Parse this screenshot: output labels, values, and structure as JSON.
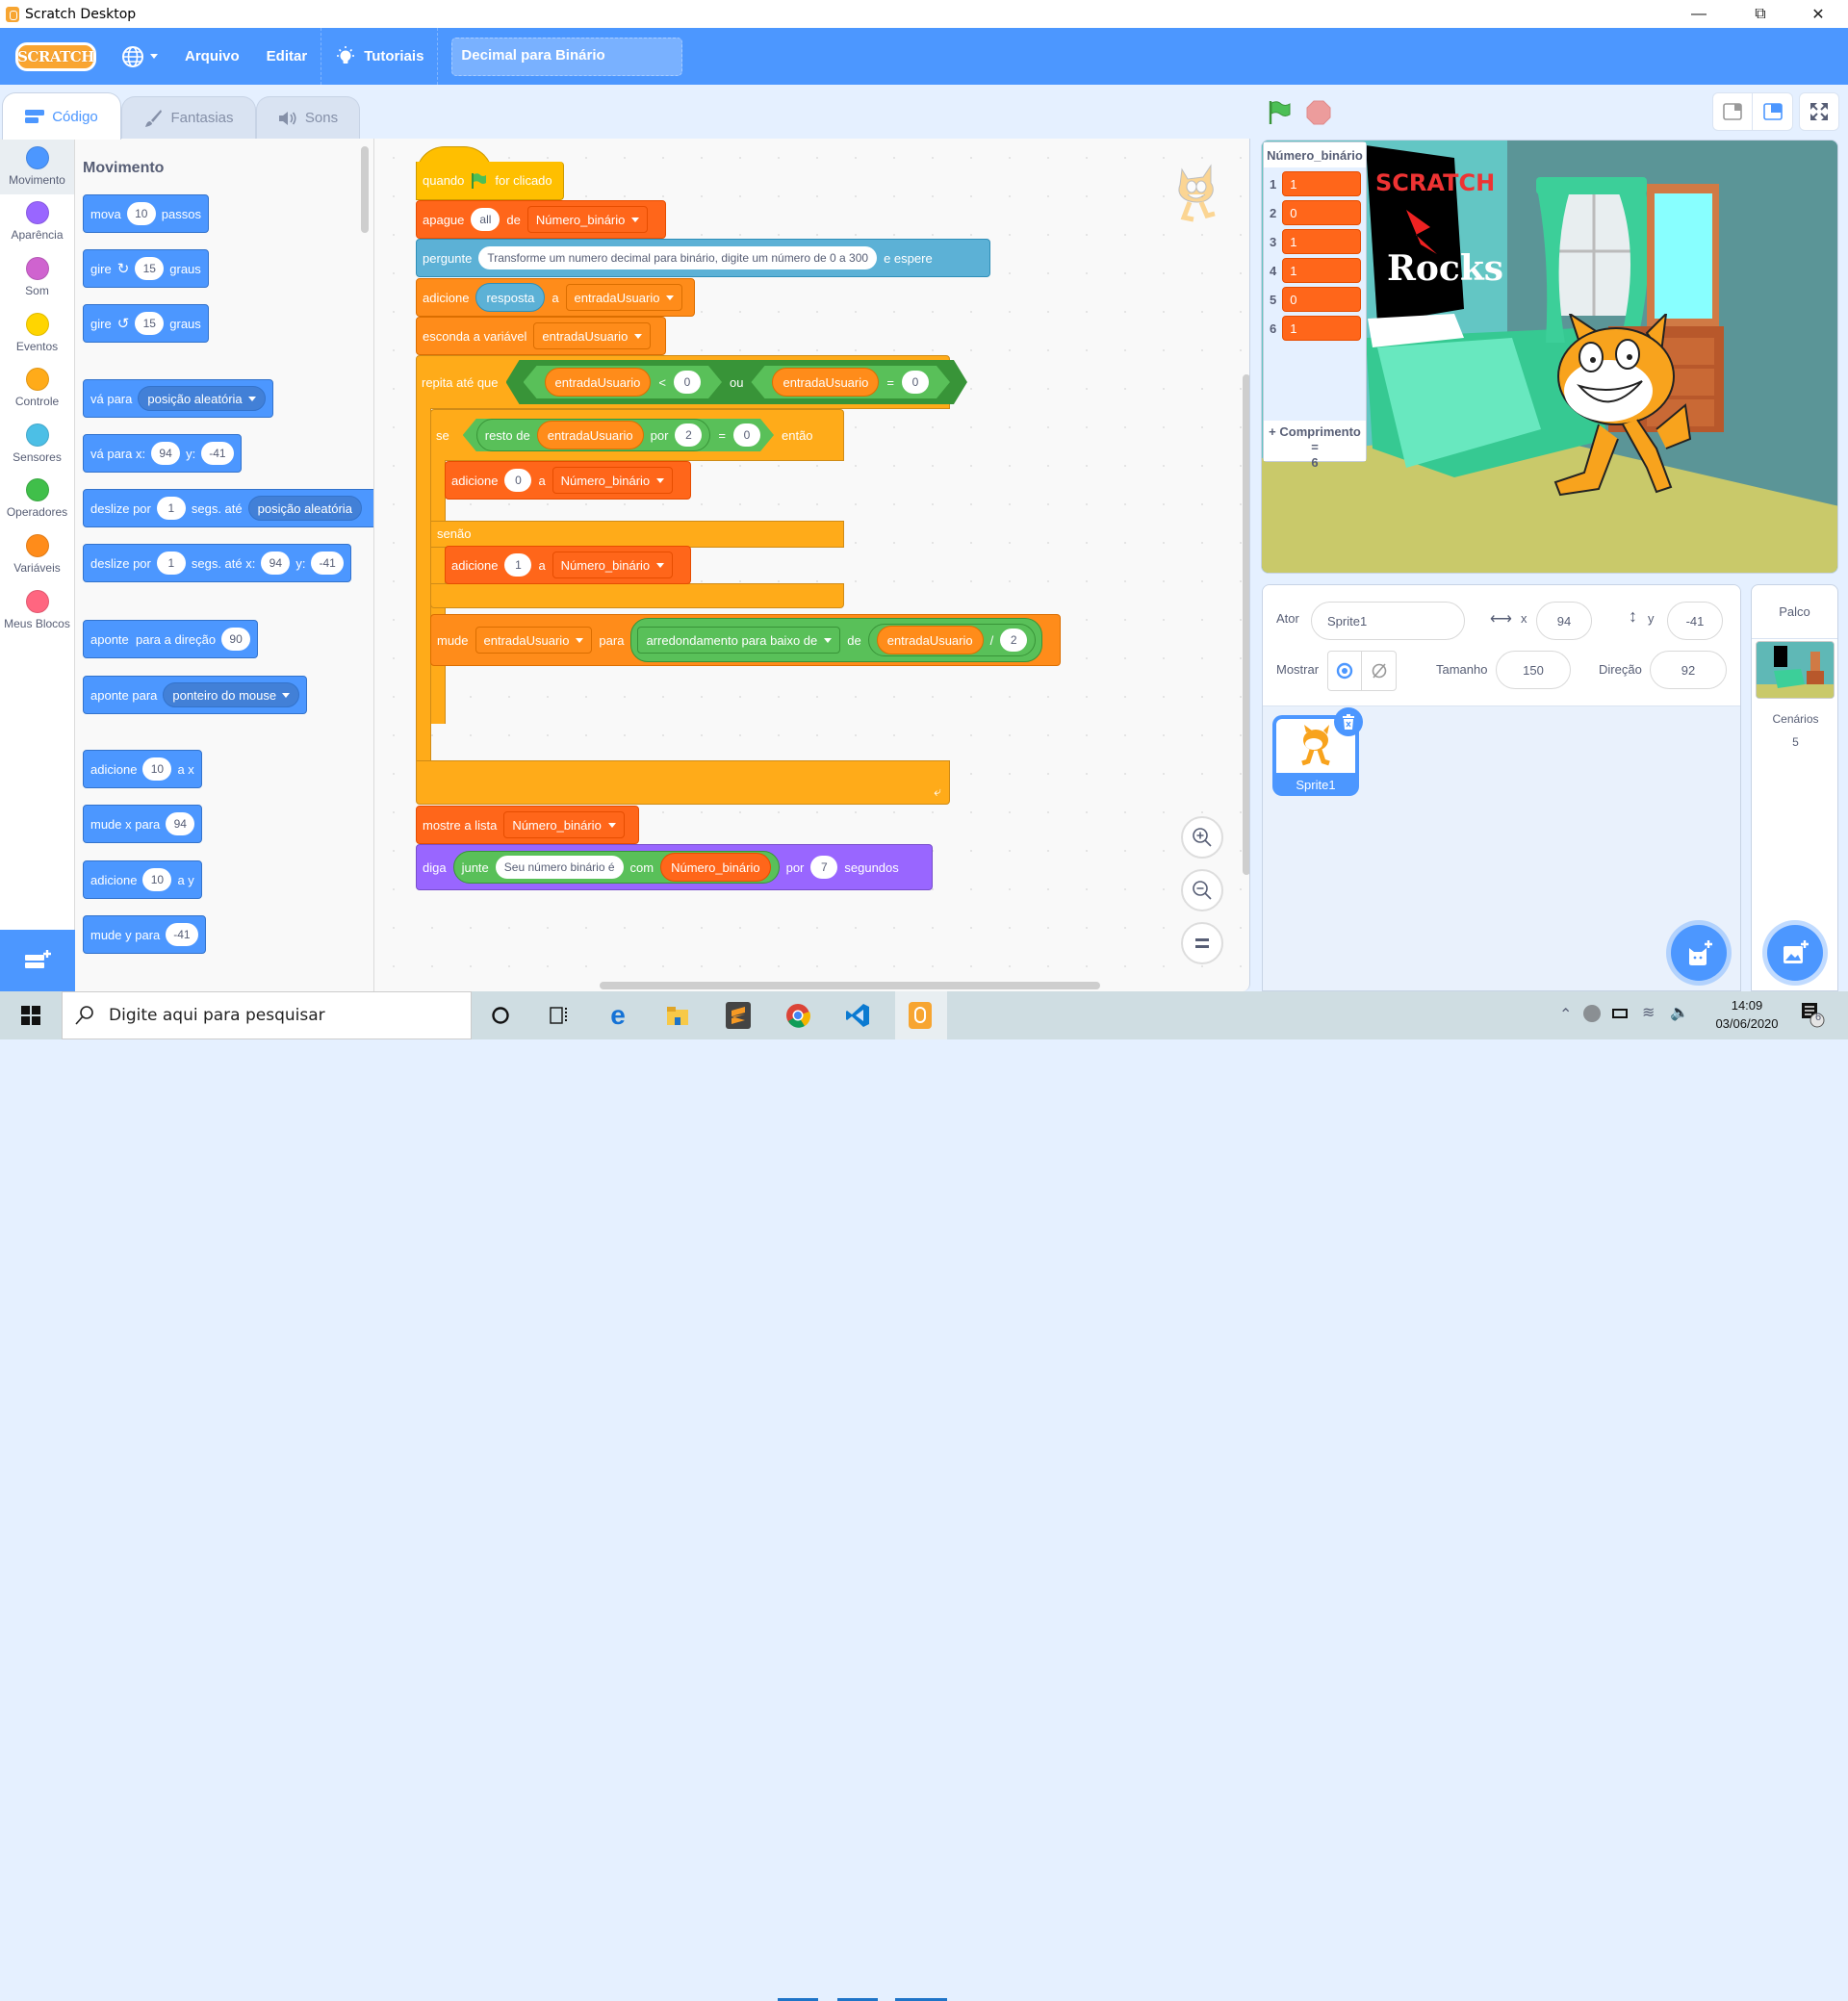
{
  "window": {
    "title": "Scratch Desktop",
    "controls": [
      "minimize-icon",
      "restore-icon",
      "close-icon"
    ]
  },
  "menubar": {
    "logo_text": "SCRATCH",
    "language_icon": "globe-icon",
    "items": [
      "Arquivo",
      "Editar"
    ],
    "tutorials": "Tutoriais",
    "project_title": "Decimal para Binário"
  },
  "tabs": [
    {
      "label": "Código",
      "icon": "code-icon",
      "active": true
    },
    {
      "label": "Fantasias",
      "icon": "brush-icon",
      "active": false
    },
    {
      "label": "Sons",
      "icon": "speaker-icon",
      "active": false
    }
  ],
  "categories": [
    {
      "label": "Movimento",
      "color": "#4c97ff",
      "active": true
    },
    {
      "label": "Aparência",
      "color": "#9966ff"
    },
    {
      "label": "Som",
      "color": "#cf63cf"
    },
    {
      "label": "Eventos",
      "color": "#ffd500"
    },
    {
      "label": "Controle",
      "color": "#ffab19"
    },
    {
      "label": "Sensores",
      "color": "#4cbfe6"
    },
    {
      "label": "Operadores",
      "color": "#40bf4a"
    },
    {
      "label": "Variáveis",
      "color": "#ff8c1a"
    },
    {
      "label": "Meus Blocos",
      "color": "#ff6680"
    }
  ],
  "palette": {
    "heading": "Movimento",
    "blocks": {
      "move": {
        "a": "mova",
        "v": "10",
        "b": "passos"
      },
      "turn_right": {
        "a": "gire",
        "v": "15",
        "b": "graus"
      },
      "turn_left": {
        "a": "gire",
        "v": "15",
        "b": "graus"
      },
      "goto": {
        "a": "vá para",
        "dd": "posição aleatória"
      },
      "goto_xy": {
        "a": "vá para x:",
        "x": "94",
        "b": "y:",
        "y": "-41"
      },
      "glide_to": {
        "a": "deslize por",
        "v": "1",
        "b": "segs. até",
        "dd": "posição aleatória"
      },
      "glide_xy": {
        "a": "deslize por",
        "v": "1",
        "b": "segs. até x:",
        "x": "94",
        "c": "y:",
        "y": "-41"
      },
      "point_dir": {
        "a": "aponte  para a direção",
        "v": "90"
      },
      "point_to": {
        "a": "aponte para",
        "dd": "ponteiro do mouse"
      },
      "change_x": {
        "a": "adicione",
        "v": "10",
        "b": "a x"
      },
      "set_x": {
        "a": "mude x para",
        "v": "94"
      },
      "change_y": {
        "a": "adicione",
        "v": "10",
        "b": "a y"
      },
      "set_y": {
        "a": "mude y para",
        "v": "-41"
      }
    }
  },
  "script": {
    "hat": {
      "a": "quando",
      "b": "for clicado"
    },
    "delete_all": {
      "a": "apague",
      "v": "all",
      "b": "de",
      "list": "Número_binário"
    },
    "ask": {
      "a": "pergunte",
      "v": "Transforme um numero decimal para binário, digite um número de 0 a 300",
      "b": "e espere"
    },
    "change_var": {
      "a": "adicione",
      "v": "resposta",
      "b": "a",
      "var": "entradaUsuario"
    },
    "hide_var": {
      "a": "esconda a variável",
      "var": "entradaUsuario"
    },
    "repeat_until": {
      "a": "repita até que",
      "lhs_var": "entradaUsuario",
      "lt": "<",
      "lt_v": "0",
      "or": "ou",
      "rhs_var": "entradaUsuario",
      "eq": "=",
      "eq_v": "0"
    },
    "if_else": {
      "a": "se",
      "mod": "resto de",
      "var": "entradaUsuario",
      "by": "por",
      "divisor": "2",
      "eq": "=",
      "cmp": "0",
      "then": "então",
      "else": "senão"
    },
    "add_zero": {
      "a": "adicione",
      "v": "0",
      "b": "a",
      "list": "Número_binário"
    },
    "add_one": {
      "a": "adicione",
      "v": "1",
      "b": "a",
      "list": "Número_binário"
    },
    "set_var": {
      "a": "mude",
      "var": "entradaUsuario",
      "b": "para",
      "fn": "arredondamento para baixo de",
      "c": "de",
      "num_var": "entradaUsuario",
      "div": "/",
      "den": "2"
    },
    "show_list": {
      "a": "mostre a lista",
      "list": "Número_binário"
    },
    "say": {
      "a": "diga",
      "join": "junte",
      "text": "Seu número binário é",
      "with": "com",
      "list": "Número_binário",
      "for": "por",
      "secs": "7",
      "b": "segundos"
    }
  },
  "zoom_controls": [
    "zoom-in-icon",
    "zoom-out-icon",
    "zoom-reset-icon"
  ],
  "stage": {
    "list_monitor": {
      "title": "Número_binário",
      "items": [
        {
          "index": "1",
          "value": "1"
        },
        {
          "index": "2",
          "value": "0"
        },
        {
          "index": "3",
          "value": "1"
        },
        {
          "index": "4",
          "value": "1"
        },
        {
          "index": "5",
          "value": "0"
        },
        {
          "index": "6",
          "value": "1"
        }
      ],
      "footer_add": "+",
      "footer_label": "Comprimento =",
      "length": "6"
    },
    "poster_line1": "SCRATCH",
    "poster_line2": "Rocks"
  },
  "sprite_info": {
    "sprite_label": "Ator",
    "sprite_name": "Sprite1",
    "x_label": "x",
    "x": "94",
    "y_label": "y",
    "y": "-41",
    "show_label": "Mostrar",
    "size_label": "Tamanho",
    "size": "150",
    "direction_label": "Direção",
    "direction": "92"
  },
  "sprites": [
    {
      "name": "Sprite1",
      "selected": true
    }
  ],
  "stage_panel": {
    "title": "Palco",
    "backdrops_label": "Cenários",
    "backdrops_count": "5"
  },
  "taskbar": {
    "search_placeholder": "Digite aqui para pesquisar",
    "time": "14:09",
    "date": "03/06/2020",
    "notifications": "6"
  }
}
